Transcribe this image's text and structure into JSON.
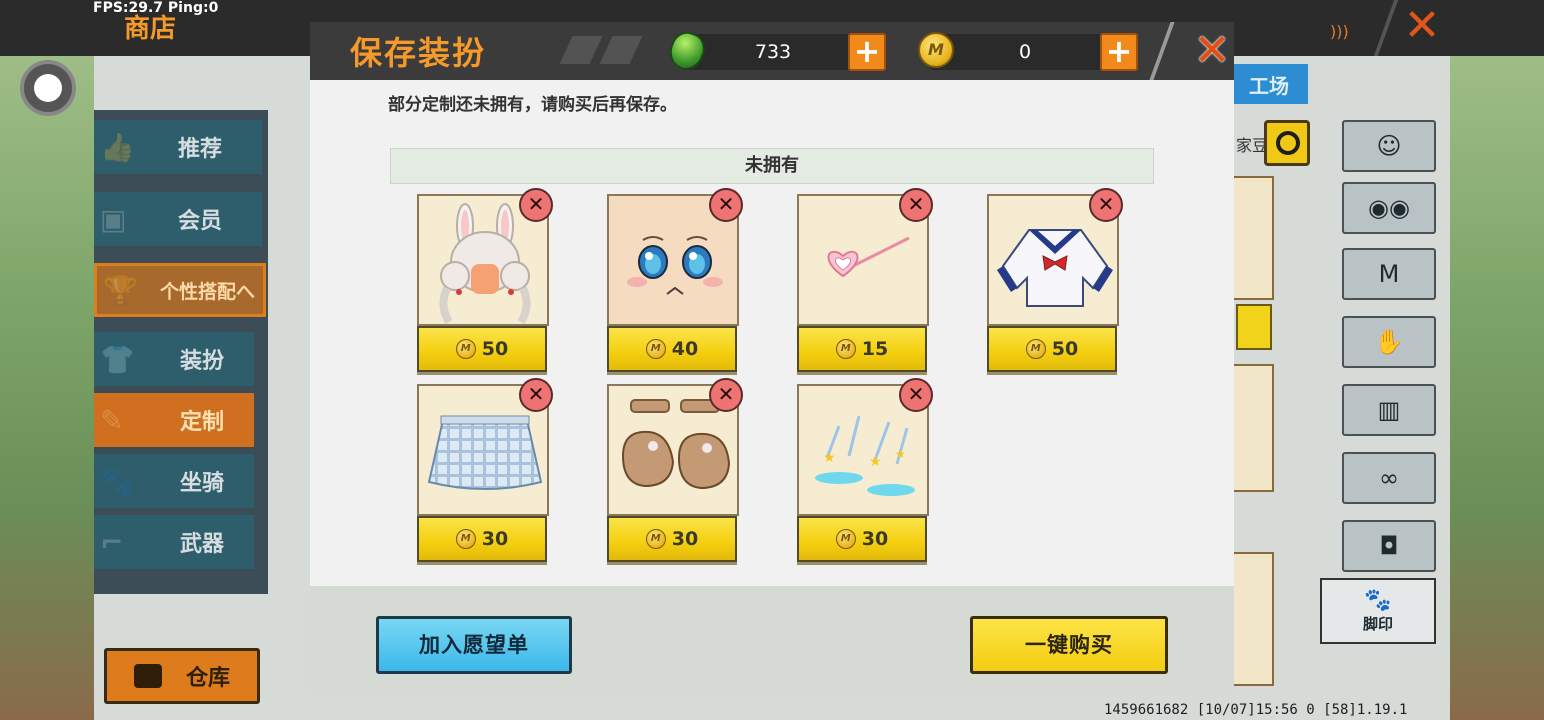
{
  "status": {
    "fps": "FPS:29.7  Ping:0"
  },
  "background": {
    "shop_title": "商店",
    "close_glyph": "✕",
    "nav": [
      {
        "label": "推荐",
        "icon": "thumbs-up-icon"
      },
      {
        "label": "会员",
        "icon": "vip-icon"
      },
      {
        "label": "个性搭配へ",
        "icon": "trophy-icon"
      },
      {
        "label": "装扮",
        "icon": "shirt-icon"
      },
      {
        "label": "定制",
        "icon": "pencil-icon"
      },
      {
        "label": "坐骑",
        "icon": "mount-icon"
      },
      {
        "label": "武器",
        "icon": "gun-icon"
      }
    ],
    "warehouse_label": "仓库",
    "workshop_tab": "工场",
    "bean_label": "家豆",
    "footprint_label": "脚印",
    "version_info": "1459661682     [10/07]15:56 0     [58]1.19.1"
  },
  "modal": {
    "title": "保存装扮",
    "currency": {
      "gems": "733",
      "coins": "0"
    },
    "close_glyph": "✕",
    "plus_glyph": "+",
    "remove_glyph": "✕",
    "coin_glyph": "M",
    "notice": "部分定制还未拥有，请购买后再保存。",
    "section_title": "未拥有",
    "items": [
      {
        "name": "bunny-ear-hair",
        "price": "50"
      },
      {
        "name": "anime-face",
        "price": "40"
      },
      {
        "name": "heart-hairpin",
        "price": "15"
      },
      {
        "name": "sailor-top",
        "price": "50"
      },
      {
        "name": "plaid-skirt",
        "price": "30"
      },
      {
        "name": "brown-shoes",
        "price": "30"
      },
      {
        "name": "sparkle-footprint",
        "price": "30"
      }
    ],
    "buttons": {
      "wishlist": "加入愿望单",
      "buy_all": "一键购买"
    }
  },
  "colors": {
    "accent_orange": "#f6992b",
    "price_yellow": "#f4cf0e",
    "wish_blue": "#3bb8e9"
  }
}
